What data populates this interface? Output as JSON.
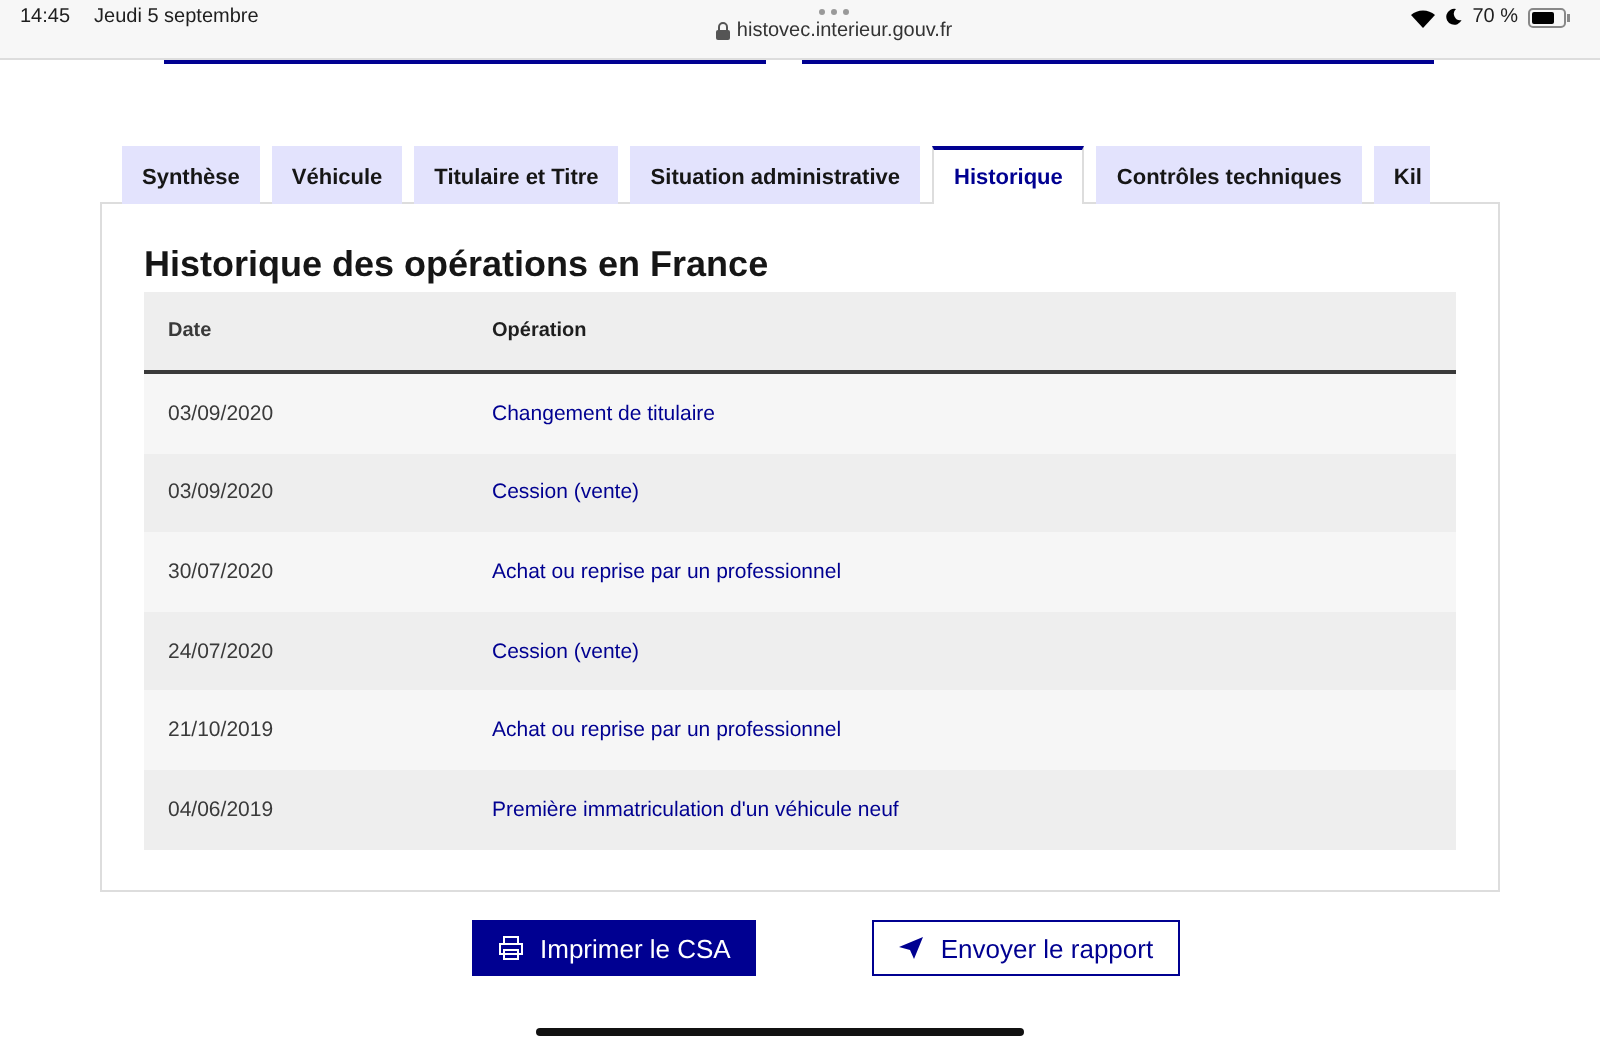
{
  "status_bar": {
    "time": "14:45",
    "date": "Jeudi 5 septembre",
    "url": "histovec.interieur.gouv.fr",
    "battery": "70 %"
  },
  "tabs": [
    {
      "label": "Synthèse",
      "selected": false
    },
    {
      "label": "Véhicule",
      "selected": false
    },
    {
      "label": "Titulaire et Titre",
      "selected": false
    },
    {
      "label": "Situation administrative",
      "selected": false
    },
    {
      "label": "Historique",
      "selected": true
    },
    {
      "label": "Contrôles techniques",
      "selected": false
    },
    {
      "label": "Kil",
      "selected": false
    }
  ],
  "section_title": "Historique des opérations en France",
  "table": {
    "columns": [
      "Date",
      "Opération"
    ],
    "rows": [
      {
        "date": "03/09/2020",
        "operation": "Changement de titulaire"
      },
      {
        "date": "03/09/2020",
        "operation": "Cession (vente)"
      },
      {
        "date": "30/07/2020",
        "operation": "Achat ou reprise par un professionnel"
      },
      {
        "date": "24/07/2020",
        "operation": "Cession (vente)"
      },
      {
        "date": "21/10/2019",
        "operation": "Achat ou reprise par un professionnel"
      },
      {
        "date": "04/06/2019",
        "operation": "Première immatriculation d'un véhicule neuf"
      }
    ]
  },
  "buttons": [
    {
      "label": "Imprimer le CSA",
      "kind": "primary"
    },
    {
      "label": "Envoyer le rapport",
      "kind": "secondary"
    }
  ]
}
